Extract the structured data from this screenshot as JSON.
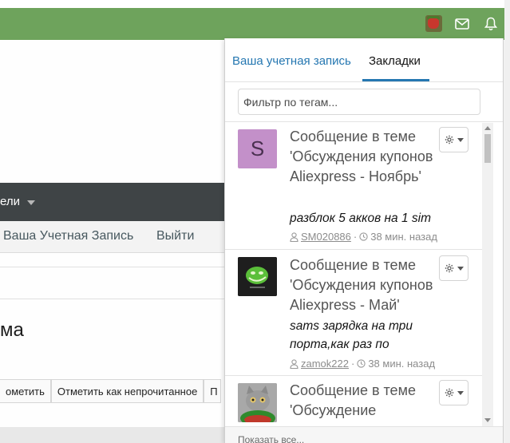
{
  "topbar": {
    "color": "#6ea35c",
    "icons": [
      "user-avatar",
      "envelope-icon",
      "bell-icon"
    ]
  },
  "background": {
    "navbar_label": "ели",
    "subnav_links": [
      "Ваша Учетная Запись",
      "Выйти"
    ],
    "title": "ма",
    "buttons": [
      "ометить",
      "Отметить как непрочитанное",
      "П"
    ]
  },
  "panel": {
    "tabs": [
      {
        "label": "Ваша учетная запись",
        "active": false
      },
      {
        "label": "Закладки",
        "active": true
      }
    ],
    "filter": {
      "placeholder": "Фильтр по тегам...",
      "value": ""
    },
    "items": [
      {
        "avatar_letter": "S",
        "title": "Сообщение в теме 'Обсуждения купонов Aliexpress - Ноябрь'",
        "snippet": "разблок 5 акков на 1 sim",
        "user": "SM020886",
        "time": "38 мин. назад"
      },
      {
        "avatar_letter": "",
        "title": "Сообщение в теме 'Обсуждения купонов Aliexpress - Май'",
        "snippet": "sams зарядка на три порта,как раз по",
        "user": "zamok222",
        "time": "38 мин. назад"
      },
      {
        "avatar_letter": "",
        "title": "Сообщение в теме 'Обсуждение",
        "snippet": "",
        "user": "",
        "time": ""
      }
    ],
    "footer_link": "Показать все..."
  },
  "colors": {
    "accent": "#2577b1",
    "green_bar": "#6ea35c",
    "dark_nav": "#3f4446",
    "avatar_s": "#c390c9"
  }
}
